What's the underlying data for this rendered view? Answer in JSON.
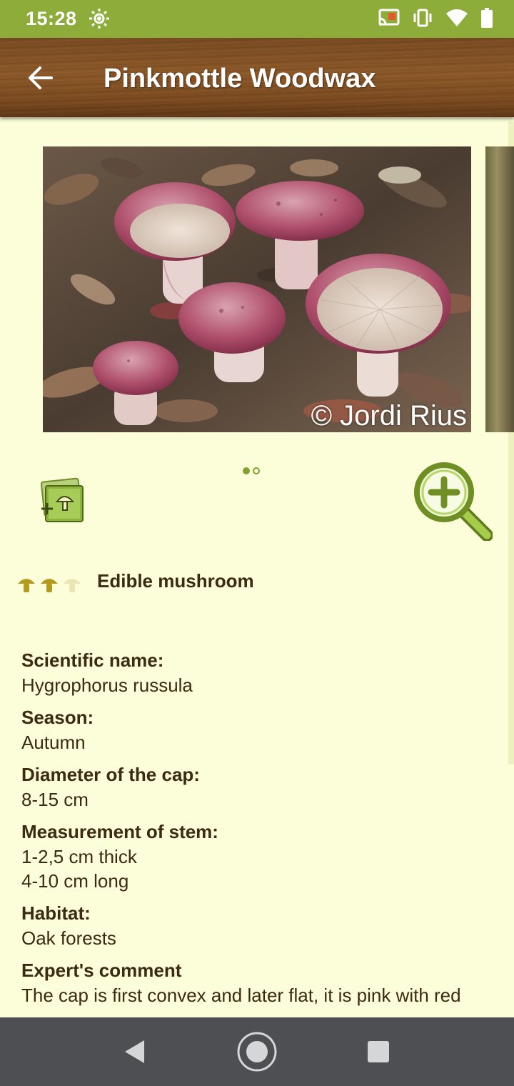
{
  "status_bar": {
    "time": "15:28",
    "icons": [
      "brightness-icon",
      "cast-icon",
      "vibrate-icon",
      "wifi-icon",
      "battery-icon"
    ]
  },
  "app_bar": {
    "title": "Pinkmottle Woodwax",
    "back_icon": "arrow-left-icon"
  },
  "gallery": {
    "photo_credit": "© Jordi Rius",
    "photo_count": 2,
    "active_index": 0,
    "add_icon": "add-to-gallery-icon",
    "zoom_icon": "zoom-in-icon"
  },
  "edibility": {
    "label": "Edible mushroom",
    "rating": 2,
    "max_rating": 3
  },
  "details": [
    {
      "label": "Scientific name:",
      "value": "Hygrophorus russula"
    },
    {
      "label": "Season:",
      "value": "Autumn"
    },
    {
      "label": "Diameter of the cap:",
      "value": "8-15 cm"
    },
    {
      "label": "Measurement of stem:",
      "value": "1-2,5 cm thick",
      "value2": "4-10 cm long"
    },
    {
      "label": "Habitat:",
      "value": "Oak forests"
    },
    {
      "label": "Expert's comment",
      "value": "The cap is first convex and later flat, it is pink with red"
    }
  ],
  "colors": {
    "status_bar": "#8dac3a",
    "background": "#fcfed9",
    "text": "#3d2a12",
    "accent_green": "#7fa22f",
    "nav_bar": "#4d4f52"
  }
}
